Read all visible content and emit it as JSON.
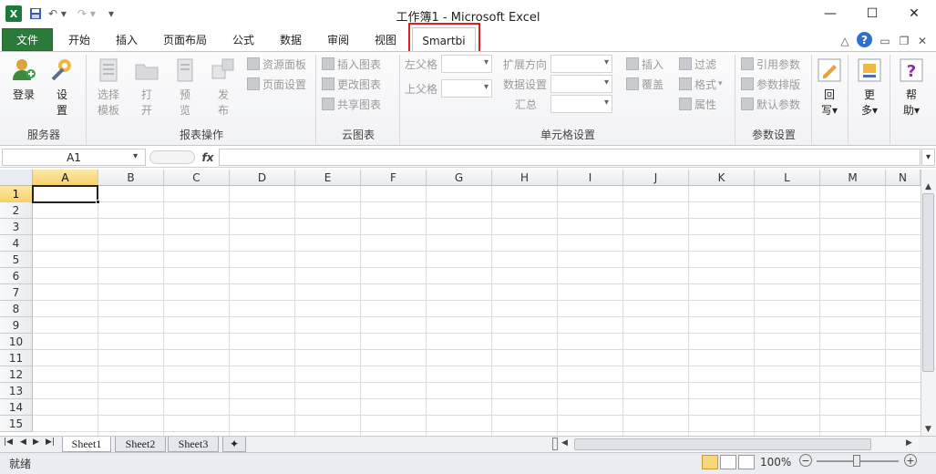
{
  "window": {
    "title": "工作簿1  -  Microsoft Excel"
  },
  "tabs": [
    "文件",
    "开始",
    "插入",
    "页面布局",
    "公式",
    "数据",
    "审阅",
    "视图",
    "Smartbi"
  ],
  "ribbon": {
    "server": {
      "login": "登录",
      "settings_l1": "设",
      "settings_l2": "置",
      "group": "服务器"
    },
    "report": {
      "select_l1": "选择",
      "select_l2": "模板",
      "open_l1": "打",
      "open_l2": "开",
      "preview_l1": "预",
      "preview_l2": "览",
      "publish_l1": "发",
      "publish_l2": "布",
      "resource_panel": "资源面板",
      "page_setup": "页面设置",
      "group": "报表操作"
    },
    "cloud": {
      "insert_chart": "插入图表",
      "change_chart": "更改图表",
      "share_chart": "共享图表",
      "group": "云图表"
    },
    "cell": {
      "left_parent": "左父格",
      "top_parent": "上父格",
      "expand_dir": "扩展方向",
      "data_settings": "数据设置",
      "summary": "汇总",
      "insert": "插入",
      "cover": "覆盖",
      "filter": "过滤",
      "format": "格式",
      "property": "属性",
      "group": "单元格设置"
    },
    "param": {
      "ref_param": "引用参数",
      "param_layout": "参数排版",
      "default_param": "默认参数",
      "group": "参数设置"
    },
    "writeback": {
      "l1": "回",
      "l2": "写"
    },
    "more": {
      "l1": "更",
      "l2": "多"
    },
    "help": {
      "l1": "帮",
      "l2": "助"
    }
  },
  "formula_bar": {
    "cell_ref": "A1",
    "fx": "fx",
    "value": ""
  },
  "columns": [
    "A",
    "B",
    "C",
    "D",
    "E",
    "F",
    "G",
    "H",
    "I",
    "J",
    "K",
    "L",
    "M",
    "N"
  ],
  "rows": [
    "1",
    "2",
    "3",
    "4",
    "5",
    "6",
    "7",
    "8",
    "9",
    "10",
    "11",
    "12",
    "13",
    "14",
    "15"
  ],
  "sheets": [
    "Sheet1",
    "Sheet2",
    "Sheet3"
  ],
  "status": {
    "ready": "就绪",
    "zoom": "100%"
  }
}
